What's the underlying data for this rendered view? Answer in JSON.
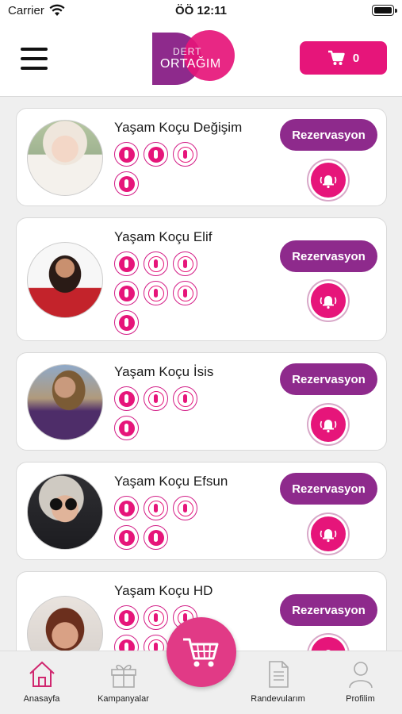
{
  "status_bar": {
    "carrier": "Carrier",
    "time": "ÖÖ 12:11"
  },
  "header": {
    "logo_line1": "DERT",
    "logo_line2": "ORTAĞIM",
    "cart_count": "0"
  },
  "coaches": [
    {
      "name": "Yaşam Koçu Değişim",
      "reserve_label": "Rezervasyon",
      "icon_count": 4
    },
    {
      "name": "Yaşam Koçu Elif",
      "reserve_label": "Rezervasyon",
      "icon_count": 7
    },
    {
      "name": "Yaşam Koçu İsis",
      "reserve_label": "Rezervasyon",
      "icon_count": 4
    },
    {
      "name": "Yaşam Koçu Efsun",
      "reserve_label": "Rezervasyon",
      "icon_count": 5
    },
    {
      "name": "Yaşam Koçu HD",
      "reserve_label": "Rezervasyon",
      "icon_count": 6
    }
  ],
  "tabbar": {
    "home": "Anasayfa",
    "campaigns": "Kampanyalar",
    "appointments": "Randevularım",
    "profile": "Profilim"
  },
  "colors": {
    "brand_pink": "#e6157a",
    "brand_purple": "#8e2a8c",
    "fab": "#e13a86"
  },
  "icons": [
    "menu-icon",
    "cart-icon",
    "wifi-icon",
    "battery-icon",
    "specialty-icon",
    "bell-icon",
    "home-icon",
    "gift-icon",
    "document-icon",
    "user-icon"
  ]
}
